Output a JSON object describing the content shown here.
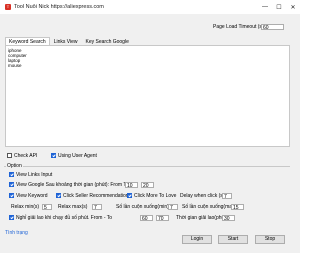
{
  "window": {
    "title": "Tool Nuôi Nick https://aliexpress.com",
    "app_icon": "T"
  },
  "window_controls": {
    "minimize": "—",
    "maximize": "☐",
    "close": "✕"
  },
  "page_load": {
    "label": "Page Load Timeout (s)",
    "value": "60"
  },
  "tabs": [
    {
      "label": "Keyword Search"
    },
    {
      "label": "Links View"
    },
    {
      "label": "Key Search Google"
    }
  ],
  "keywords": [
    "iphone",
    "computer",
    "laptop",
    "mouse"
  ],
  "check_api": {
    "label": "Check API",
    "checked": false
  },
  "use_user_agent": {
    "label": "Using User Agent",
    "checked": true
  },
  "option": {
    "title": "Option",
    "view_links_input": {
      "label": "View Links Input",
      "checked": true
    },
    "view_google": {
      "label": "View Google Sau khoảng thời gian (phút): From To",
      "checked": true,
      "from": "10",
      "to": "20"
    },
    "view_keyword": {
      "label": "View Keyword",
      "checked": true
    },
    "click_seller": {
      "label": "Click Seller Recommendations",
      "checked": true
    },
    "click_more_love": {
      "label": "Click More To Love",
      "checked": true
    },
    "delay_click": {
      "label": "Delay when click (s)",
      "value": "7"
    },
    "relax_min": {
      "label": "Relax min(s)",
      "value": "5"
    },
    "relax_max": {
      "label": "Relax max(s)",
      "value": "7"
    },
    "scroll_min": {
      "label": "Số lần cuộn xuống(min)",
      "value": "7"
    },
    "scroll_max": {
      "label": "Số lần cuộn xuống(max)",
      "value": "15"
    },
    "rest": {
      "label": "Nghỉ giải lao khi chạy đủ số phút. From - To",
      "checked": true,
      "from": "60",
      "to": "70"
    },
    "rest_time": {
      "label": "Thời gian giải lao(phút)",
      "value": "30"
    }
  },
  "status_link": "Tình trạng",
  "buttons": {
    "login": "Login",
    "start": "Start",
    "stop": "Stop"
  }
}
